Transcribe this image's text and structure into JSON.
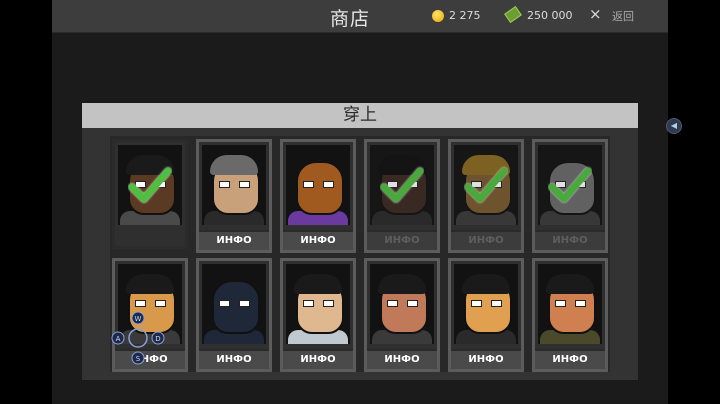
{
  "header": {
    "title": "商店",
    "coins": "2 275",
    "cash": "250 000",
    "close_icon": "×",
    "back_label": "返回"
  },
  "panel": {
    "title": "穿上"
  },
  "characters": [
    {
      "skin": "#5a3a22",
      "hair": "#1a1a1a",
      "body": "#4a4a4a",
      "owned": true,
      "checked": true,
      "mask": false,
      "info": ""
    },
    {
      "skin": "#c8a07a",
      "hair": "#6a6a6a",
      "body": "#2a2a2a",
      "owned": false,
      "checked": false,
      "mask": false,
      "info": "ИНФО"
    },
    {
      "skin": "#a05a20",
      "hair": "#a05a20",
      "body": "#6a3aa0",
      "owned": false,
      "checked": false,
      "mask": true,
      "info": "ИНФО"
    },
    {
      "skin": "#3a2a20",
      "hair": "#101010",
      "body": "#2a2a2a",
      "owned": false,
      "checked": true,
      "mask": false,
      "info": "ИНФО"
    },
    {
      "skin": "#7a5a30",
      "hair": "#8a6a20",
      "body": "#3a3a3a",
      "owned": false,
      "checked": true,
      "mask": false,
      "info": "ИНФО"
    },
    {
      "skin": "#6a6a6a",
      "hair": "#8a8a8a",
      "body": "#3a3a3a",
      "owned": false,
      "checked": true,
      "mask": true,
      "info": "ИНФО"
    },
    {
      "skin": "#d89a4a",
      "hair": "#1a1a1a",
      "body": "#3a3a3a",
      "owned": false,
      "checked": false,
      "mask": false,
      "info": "ИНФО"
    },
    {
      "skin": "#1e2838",
      "hair": "#1e2838",
      "body": "#1e2838",
      "owned": false,
      "checked": false,
      "mask": true,
      "info": "ИНФО"
    },
    {
      "skin": "#e0b890",
      "hair": "#1a1a1a",
      "body": "#c0c8d0",
      "owned": false,
      "checked": false,
      "mask": false,
      "info": "ИНФО"
    },
    {
      "skin": "#c07a5a",
      "hair": "#1a1a1a",
      "body": "#3a3a3a",
      "owned": false,
      "checked": false,
      "mask": false,
      "info": "ИНФО"
    },
    {
      "skin": "#e0a050",
      "hair": "#1a1a1a",
      "body": "#2a2a2a",
      "owned": false,
      "checked": false,
      "mask": false,
      "info": "ИНФО"
    },
    {
      "skin": "#d08050",
      "hair": "#1a1a1a",
      "body": "#4a4a2a",
      "owned": false,
      "checked": false,
      "mask": false,
      "info": "ИНФО"
    }
  ],
  "dpad": {
    "keys": [
      "W",
      "A",
      "S",
      "D"
    ]
  },
  "colors": {
    "check": "#4fbf3f",
    "panel_header": "#c3c3c3"
  }
}
